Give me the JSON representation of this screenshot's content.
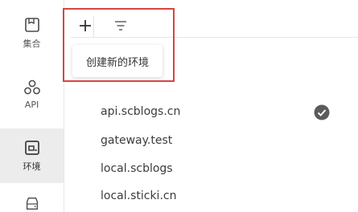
{
  "sidebar": {
    "items": [
      {
        "label": "集合",
        "icon": "collection-icon"
      },
      {
        "label": "API",
        "icon": "api-icon"
      },
      {
        "label": "环境",
        "icon": "environment-icon",
        "active": true
      },
      {
        "label": "",
        "icon": "drive-icon"
      }
    ]
  },
  "toolbar": {
    "add_icon": "plus-icon",
    "filter_icon": "filter-icon",
    "add_tooltip": "创建新的环境"
  },
  "environments": [
    {
      "name": "api.scblogs.cn",
      "selected": true
    },
    {
      "name": "gateway.test",
      "selected": false
    },
    {
      "name": "local.scblogs",
      "selected": false
    },
    {
      "name": "local.sticki.cn",
      "selected": false
    }
  ],
  "colors": {
    "highlight": "#d6453f",
    "active_bg": "#ececec",
    "check": "#5b5b5b"
  }
}
